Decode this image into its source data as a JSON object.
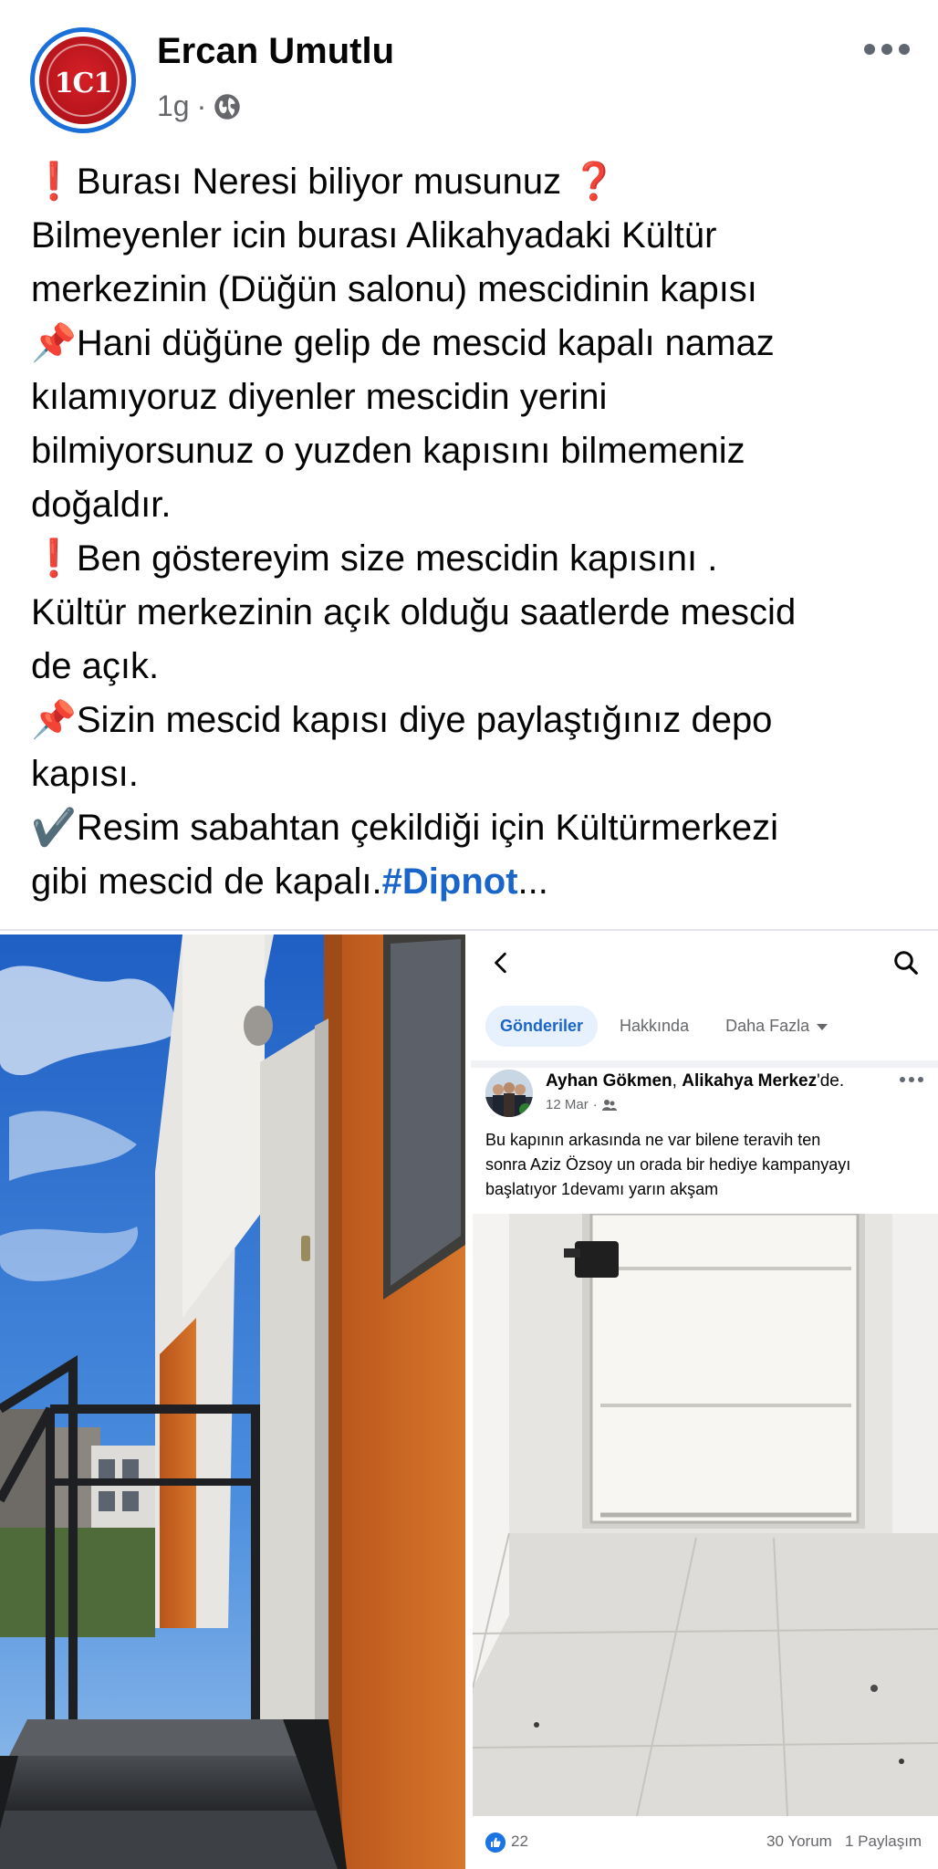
{
  "post": {
    "author": "Ercan Umutlu",
    "time": "1g",
    "meta_separator": "·",
    "audience_icon": "globe-icon",
    "avatar_text": "1C1",
    "text_lines": [
      {
        "emoji": "❗",
        "text": "Burası Neresi biliyor musunuz ",
        "trail": "❓"
      },
      {
        "text": "Bilmeyenler icin burası Alikahyadaki Kültür"
      },
      {
        "text": "merkezinin (Düğün salonu) mescidinin kapısı"
      },
      {
        "emoji": "📌",
        "text": "Hani düğüne gelip de mescid kapalı namaz"
      },
      {
        "text": "kılamıyoruz diyenler mescidin yerini"
      },
      {
        "text": "bilmiyorsunuz o yuzden kapısını bilmemeniz"
      },
      {
        "text": "doğaldır."
      },
      {
        "emoji": "❗",
        "text": "Ben göstereyim  size mescidin kapısını ."
      },
      {
        "text": "Kültür merkezinin açık olduğu saatlerde mescid"
      },
      {
        "text": "de açık."
      },
      {
        "emoji": "📌",
        "text": "Sizin mescid kapısı diye paylaştığınız depo"
      },
      {
        "text": "kapısı."
      },
      {
        "emoji": "✔️",
        "text": "Resim sabahtan çekildiği için Kültürmerkezi"
      },
      {
        "text": "gibi mescid de kapalı.",
        "hashtag": "#Dipnot",
        "more": "..."
      }
    ]
  },
  "embedded": {
    "tabs": [
      "Gönderiler",
      "Hakkında",
      "Daha Fazla"
    ],
    "author": "Ayhan Gökmen",
    "author_separator": ", ",
    "location": "Alikahya Merkez",
    "location_suffix": "'de.",
    "date": "12 Mar",
    "text_lines": [
      "Bu kapının arkasında ne var bilene teravih ten",
      "sonra Aziz Özsoy un orada bir hediye kampanyayı",
      "başlatıyor 1devamı yarın akşam"
    ],
    "likes": "22",
    "comments": "30 Yorum",
    "shares": "1 Paylaşım"
  },
  "colors": {
    "hashtag": "#1a65c9",
    "secondary_text": "#65676b",
    "active_tab_bg": "#e7f0fd",
    "wall_orange": "#c8641e"
  }
}
